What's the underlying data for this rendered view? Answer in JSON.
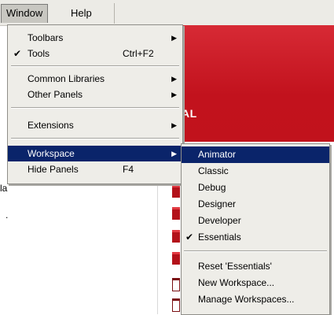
{
  "menubar": {
    "window": "Window",
    "help": "Help"
  },
  "backdrop": {
    "banner_text": "AL",
    "list_text_1": "la",
    "list_text_2": "."
  },
  "menu": {
    "toolbars": "Toolbars",
    "tools": "Tools",
    "tools_shortcut": "Ctrl+F2",
    "common_libraries": "Common Libraries",
    "other_panels": "Other Panels",
    "extensions": "Extensions",
    "workspace": "Workspace",
    "hide_panels": "Hide Panels",
    "hide_panels_shortcut": "F4"
  },
  "workspace_submenu": {
    "animator": "Animator",
    "classic": "Classic",
    "debug": "Debug",
    "designer": "Designer",
    "developer": "Developer",
    "essentials": "Essentials",
    "reset": "Reset 'Essentials'",
    "new_workspace": "New Workspace...",
    "manage_workspaces": "Manage Workspaces..."
  },
  "colors": {
    "highlight": "#0a246a",
    "menu_bg": "#eeede8",
    "banner": "#c8141f"
  }
}
